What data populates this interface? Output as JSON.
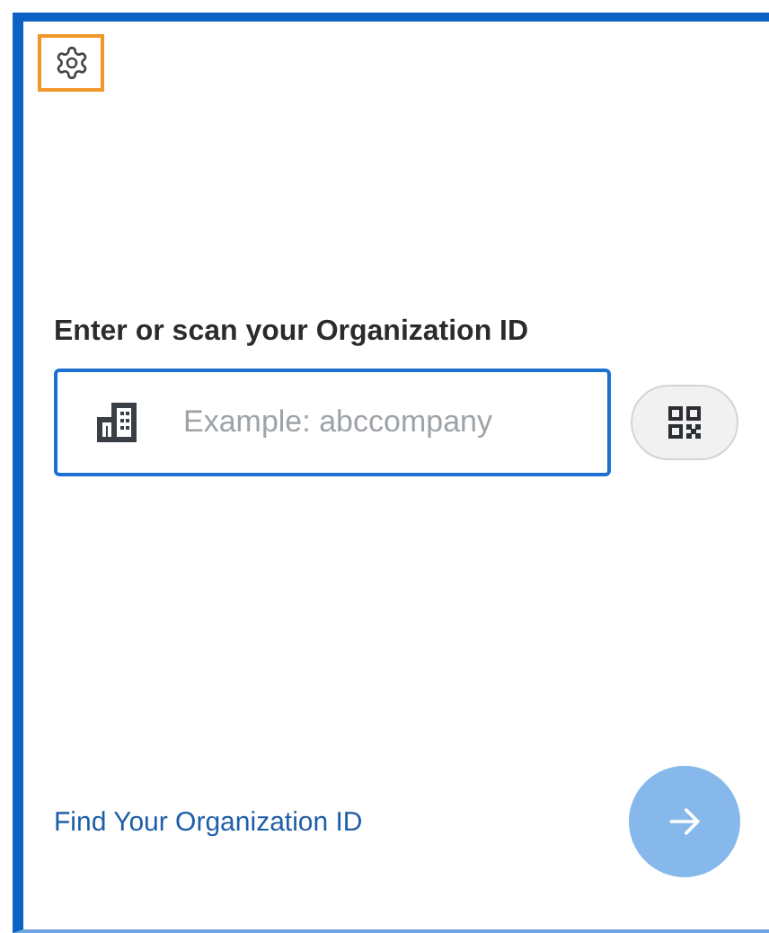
{
  "settings": {
    "focused": true
  },
  "heading": "Enter or scan your Organization ID",
  "org_field": {
    "placeholder": "Example: abccompany"
  },
  "find_link": "Find Your Organization ID",
  "submit": {
    "disabled": true
  }
}
